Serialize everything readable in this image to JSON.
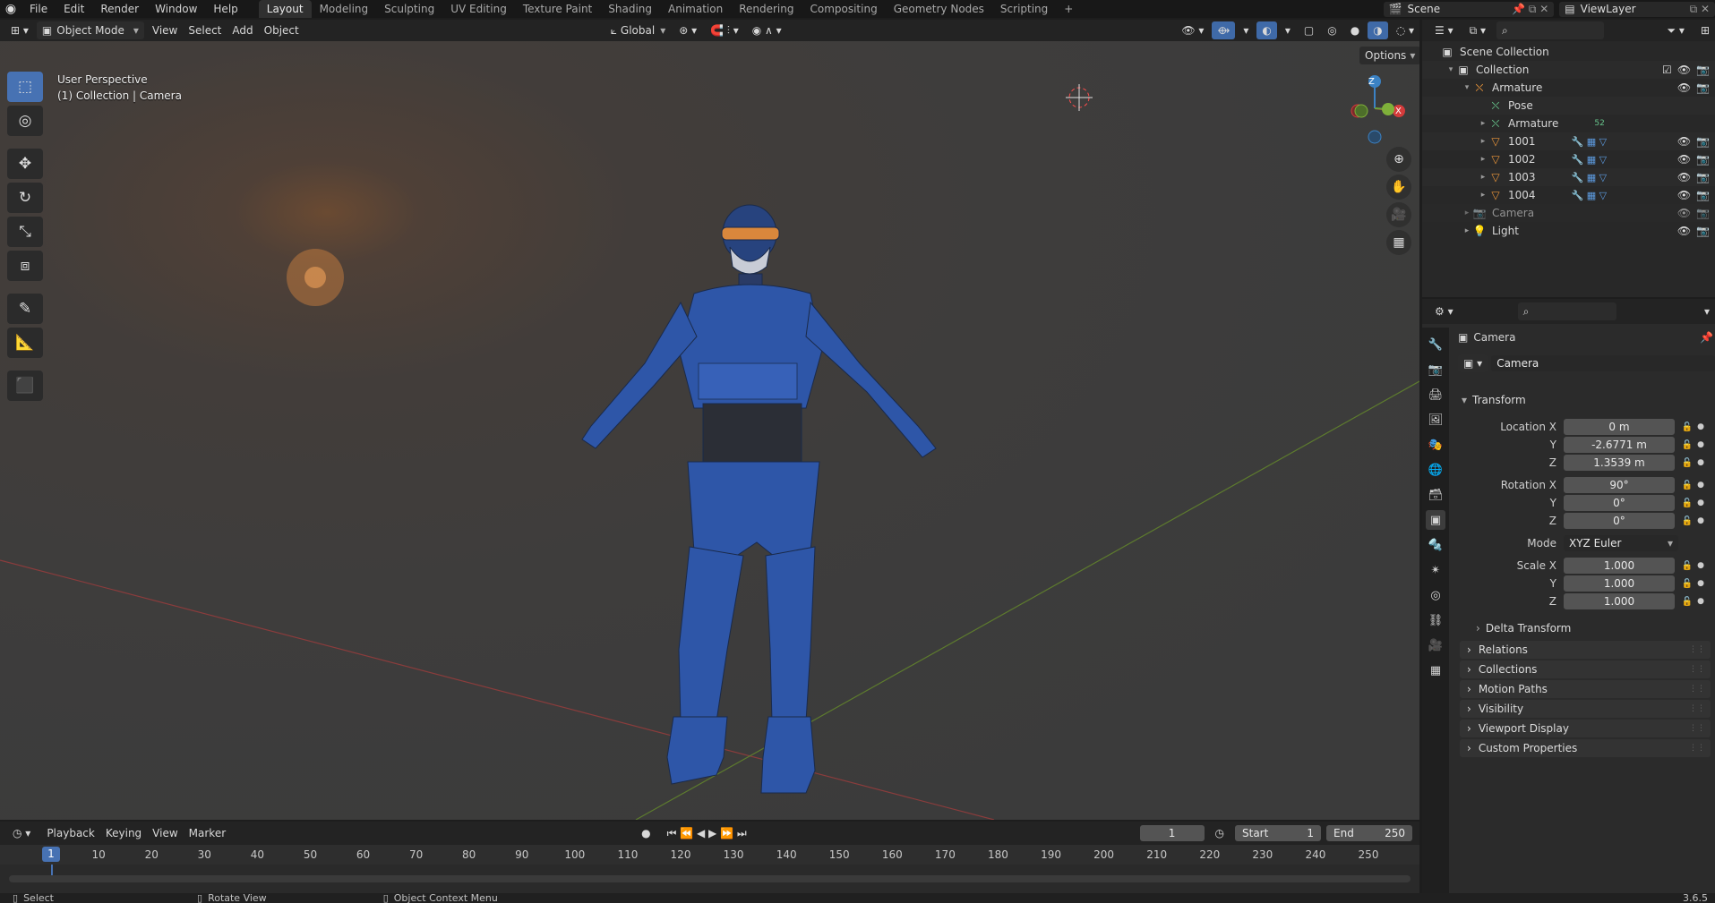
{
  "menu": [
    "File",
    "Edit",
    "Render",
    "Window",
    "Help"
  ],
  "workspaces": [
    "Layout",
    "Modeling",
    "Sculpting",
    "UV Editing",
    "Texture Paint",
    "Shading",
    "Animation",
    "Rendering",
    "Compositing",
    "Geometry Nodes",
    "Scripting"
  ],
  "active_workspace": "Layout",
  "add_tab_label": "+",
  "scene_name": "Scene",
  "view_layer": "ViewLayer",
  "viewport": {
    "mode": "Object Mode",
    "menus": [
      "View",
      "Select",
      "Add",
      "Object"
    ],
    "orientation": "Global",
    "options_label": "Options",
    "overlay_line1": "User Perspective",
    "overlay_line2": "(1) Collection | Camera",
    "gizmo_axes": {
      "z": "Z",
      "x": "X"
    },
    "tools": [
      {
        "name": "select-box",
        "glyph": "⬚"
      },
      {
        "name": "cursor",
        "glyph": "◎"
      },
      {
        "name": "move",
        "glyph": "✥"
      },
      {
        "name": "rotate",
        "glyph": "↻"
      },
      {
        "name": "scale",
        "glyph": "⤡"
      },
      {
        "name": "transform",
        "glyph": "⧈"
      },
      {
        "name": "annotate",
        "glyph": "✎"
      },
      {
        "name": "measure",
        "glyph": "📐"
      },
      {
        "name": "add-cube",
        "glyph": "⬛"
      }
    ],
    "nav_buttons": [
      {
        "name": "zoom",
        "glyph": "⊕"
      },
      {
        "name": "pan",
        "glyph": "✋"
      },
      {
        "name": "camera-view",
        "glyph": "🎥"
      },
      {
        "name": "ortho-grid",
        "glyph": "▦"
      }
    ]
  },
  "outliner": {
    "rows": [
      {
        "label": "Scene Collection",
        "indent": 0,
        "icon": "scene-collection-icon",
        "glyph": "▣",
        "tri": "",
        "vis": false,
        "alt": false
      },
      {
        "label": "Collection",
        "indent": 1,
        "icon": "collection-icon",
        "glyph": "▣",
        "tri": "▾",
        "vis": true,
        "alt": true,
        "check": true
      },
      {
        "label": "Armature",
        "indent": 2,
        "icon": "armature-icon",
        "glyph": "⛌",
        "tri": "▾",
        "vis": true,
        "alt": false,
        "color": "orng"
      },
      {
        "label": "Pose",
        "indent": 3,
        "icon": "pose-icon",
        "glyph": "⛌",
        "tri": "",
        "vis": false,
        "alt": true,
        "color": "grn"
      },
      {
        "label": "Armature",
        "indent": 3,
        "icon": "armature-data-icon",
        "glyph": "⛌",
        "tri": "▸",
        "vis": false,
        "alt": false,
        "color": "grn",
        "badge": "52"
      },
      {
        "label": "1001",
        "indent": 3,
        "icon": "mesh-icon",
        "glyph": "▽",
        "tri": "▸",
        "vis": true,
        "alt": true,
        "color": "orng",
        "mods": true
      },
      {
        "label": "1002",
        "indent": 3,
        "icon": "mesh-icon",
        "glyph": "▽",
        "tri": "▸",
        "vis": true,
        "alt": false,
        "color": "orng",
        "mods": true
      },
      {
        "label": "1003",
        "indent": 3,
        "icon": "mesh-icon",
        "glyph": "▽",
        "tri": "▸",
        "vis": true,
        "alt": true,
        "color": "orng",
        "mods": true
      },
      {
        "label": "1004",
        "indent": 3,
        "icon": "mesh-icon",
        "glyph": "▽",
        "tri": "▸",
        "vis": true,
        "alt": false,
        "color": "orng",
        "mods": true
      },
      {
        "label": "Camera",
        "indent": 2,
        "icon": "camera-icon",
        "glyph": "📷",
        "tri": "▸",
        "vis": true,
        "alt": true,
        "dim": true
      },
      {
        "label": "Light",
        "indent": 2,
        "icon": "light-icon",
        "glyph": "💡",
        "tri": "▸",
        "vis": true,
        "alt": false
      }
    ]
  },
  "properties": {
    "context_title": "Camera",
    "object_name": "Camera",
    "transform_header": "Transform",
    "location": {
      "label_x": "Location X",
      "x": "0 m",
      "y": "-2.6771 m",
      "z": "1.3539 m"
    },
    "rotation": {
      "label_x": "Rotation X",
      "x": "90°",
      "y": "0°",
      "z": "0°"
    },
    "mode_label": "Mode",
    "mode_value": "XYZ Euler",
    "scale": {
      "label_x": "Scale X",
      "x": "1.000",
      "y": "1.000",
      "z": "1.000"
    },
    "axis_y": "Y",
    "axis_z": "Z",
    "delta_transform": "Delta Transform",
    "panels": [
      "Relations",
      "Collections",
      "Motion Paths",
      "Visibility",
      "Viewport Display",
      "Custom Properties"
    ]
  },
  "timeline": {
    "menus": [
      "Playback",
      "Keying",
      "View",
      "Marker"
    ],
    "current_frame": "1",
    "start_label": "Start",
    "start": "1",
    "end_label": "End",
    "end": "250",
    "ticks": [
      "10",
      "20",
      "30",
      "40",
      "50",
      "60",
      "70",
      "80",
      "90",
      "100",
      "110",
      "120",
      "130",
      "140",
      "150",
      "160",
      "170",
      "180",
      "190",
      "200",
      "210",
      "220",
      "230",
      "240",
      "250"
    ]
  },
  "statusbar": {
    "select": "Select",
    "rotate_view": "Rotate View",
    "context_menu": "Object Context Menu",
    "version": "3.6.5"
  }
}
